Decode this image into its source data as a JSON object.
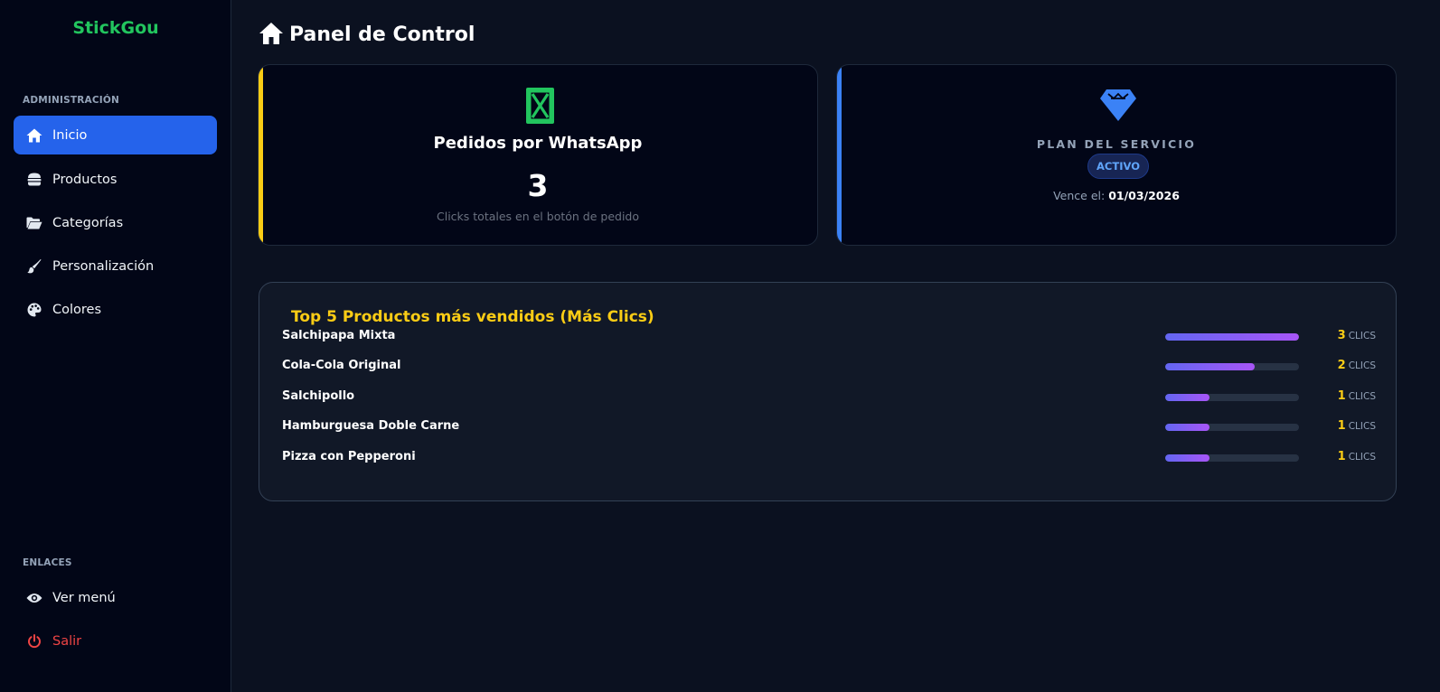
{
  "sidebar": {
    "brand": "StickGou",
    "admin_label": "ADMINISTRACIÓN",
    "items": [
      {
        "label": "Inicio",
        "icon": "home-icon",
        "active": true
      },
      {
        "label": "Productos",
        "icon": "burger-icon"
      },
      {
        "label": "Categorías",
        "icon": "folder-icon"
      },
      {
        "label": "Personalización",
        "icon": "brush-icon"
      },
      {
        "label": "Colores",
        "icon": "palette-icon"
      }
    ],
    "links_label": "ENLACES",
    "links": [
      {
        "label": "Ver menú",
        "icon": "eye-icon"
      },
      {
        "label": "Salir",
        "icon": "power-icon"
      }
    ]
  },
  "header": {
    "title": "Panel de Control",
    "icon": "home-icon"
  },
  "whatsapp_card": {
    "title": "Pedidos por WhatsApp",
    "count": "3",
    "subtitle": "Clicks totales en el botón de pedido",
    "icon": "whatsapp-icon"
  },
  "plan_card": {
    "title": "PLAN DEL SERVICIO",
    "status": "ACTIVO",
    "expires_label": "Vence el:",
    "expires_date": "01/03/2026",
    "icon": "gem-icon"
  },
  "top_products": {
    "title": "Top 5 Productos más vendidos (Más Clics)",
    "unit": "clics",
    "items": [
      {
        "name": "Salchipapa Mixta",
        "clicks": "3",
        "fraction": 1.0
      },
      {
        "name": "Cola-Cola Original",
        "clicks": "2",
        "fraction": 0.667
      },
      {
        "name": "Salchipollo",
        "clicks": "1",
        "fraction": 0.333
      },
      {
        "name": "Hamburguesa Doble Carne",
        "clicks": "1",
        "fraction": 0.333
      },
      {
        "name": "Pizza con Pepperoni",
        "clicks": "1",
        "fraction": 0.333
      }
    ]
  },
  "colors": {
    "brand": "#22c55e",
    "active_nav": "#2563eb",
    "accent_yellow": "#facc15",
    "accent_blue": "#3b82f6",
    "danger": "#ef4444"
  }
}
